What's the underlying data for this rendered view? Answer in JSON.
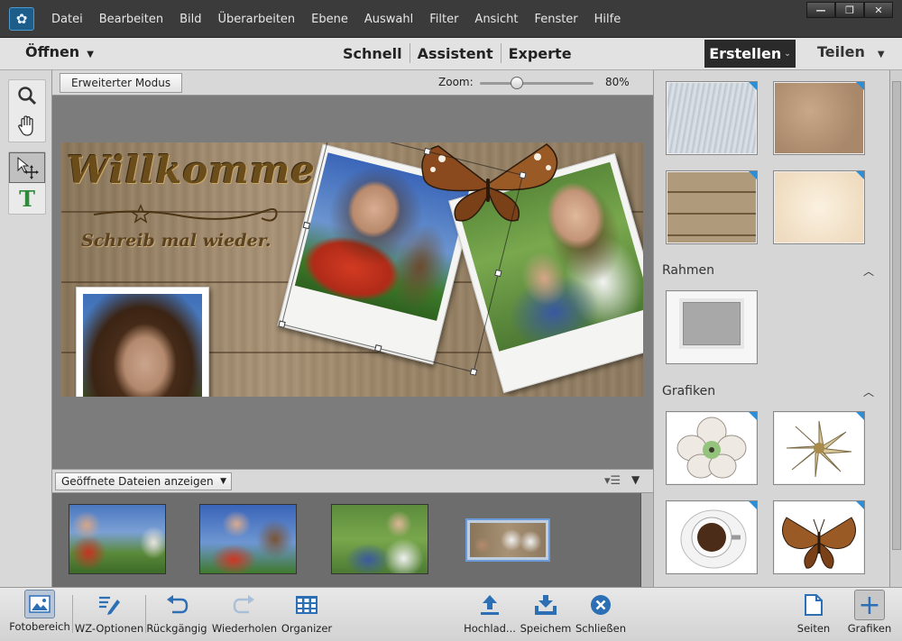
{
  "menu": {
    "items": [
      "Datei",
      "Bearbeiten",
      "Bild",
      "Überarbeiten",
      "Ebene",
      "Auswahl",
      "Filter",
      "Ansicht",
      "Fenster",
      "Hilfe"
    ]
  },
  "window_controls": {
    "minimize": "—",
    "restore": "❐",
    "close": "✕"
  },
  "modebar": {
    "open_label": "Öffnen",
    "tabs": [
      "Schnell",
      "Assistent",
      "Experte"
    ],
    "create_label": "Erstellen",
    "share_label": "Teilen"
  },
  "canvas_toolbar": {
    "extended_mode_label": "Erweiterter Modus",
    "zoom_label": "Zoom:",
    "zoom_value": "80%",
    "zoom_fraction": 0.3
  },
  "document": {
    "headline": "Willkommen!",
    "subline": "Schreib mal wieder."
  },
  "project_bin": {
    "selector_label": "Geöffnete Dateien anzeigen"
  },
  "right_panel": {
    "sections": [
      {
        "title": "Rahmen"
      },
      {
        "title": "Grafiken"
      }
    ]
  },
  "taskbar": {
    "photo_bin": "Fotobereich",
    "tool_options": "WZ-Optionen",
    "undo": "Rückgängig",
    "redo": "Wiederholen",
    "organizer": "Organizer",
    "upload": "Hochlad...",
    "save": "Speichem",
    "close": "Schließen",
    "pages": "Seiten",
    "graphics": "Grafiken"
  },
  "colors": {
    "accent_blue": "#2d6fb5",
    "create_bg": "#2a2a2a",
    "titlebar_bg": "#3b3b3b"
  },
  "icons": {
    "app_logo": "elements-logo-icon",
    "zoom_tool": "magnifier-icon",
    "hand_tool": "hand-icon",
    "move_tool": "move-icon",
    "text_tool": "text-tool-icon"
  }
}
